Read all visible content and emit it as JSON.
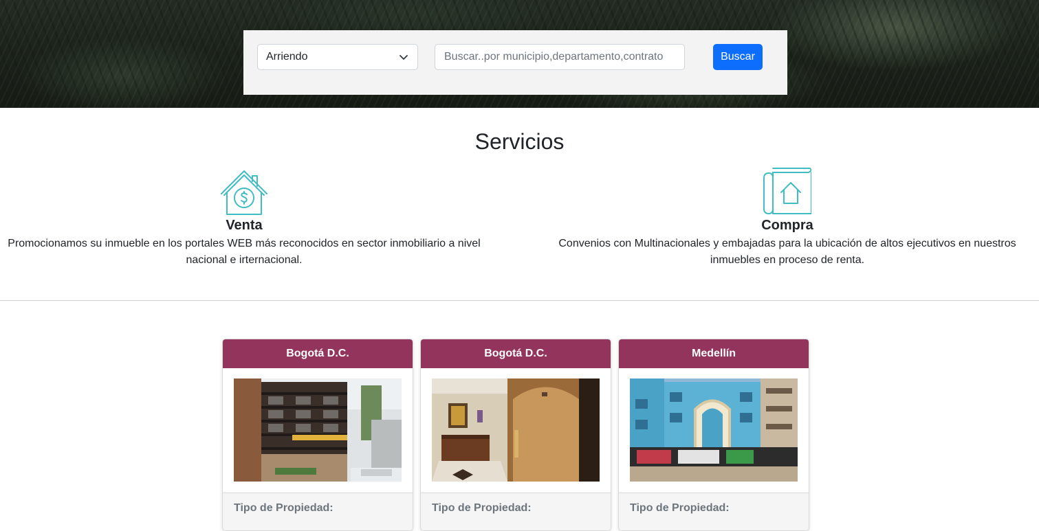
{
  "search": {
    "contract_selected": "Arriendo",
    "placeholder": "Buscar..por municipio,departamento,contrato",
    "button_label": "Buscar"
  },
  "services": {
    "title": "Servicios",
    "items": [
      {
        "icon": "house-dollar-icon",
        "title": "Venta",
        "description": "Promocionamos su inmueble en los portales WEB más reconocidos en sector inmobiliario a nivel nacional e irternacional."
      },
      {
        "icon": "house-document-icon",
        "title": "Compra",
        "description": "Convenios con Multinacionales y embajadas para la ubicación de altos ejecutivos en nuestros inmuebles en proceso de renta."
      }
    ]
  },
  "properties": [
    {
      "city": "Bogotá D.C.",
      "label": "Tipo de Propiedad:"
    },
    {
      "city": "Bogotá D.C.",
      "label": "Tipo de Propiedad:"
    },
    {
      "city": "Medellín",
      "label": "Tipo de Propiedad:"
    }
  ],
  "colors": {
    "accent": "#93345d",
    "primary_button": "#0d6efd",
    "icon_teal": "#3fbcc4"
  }
}
